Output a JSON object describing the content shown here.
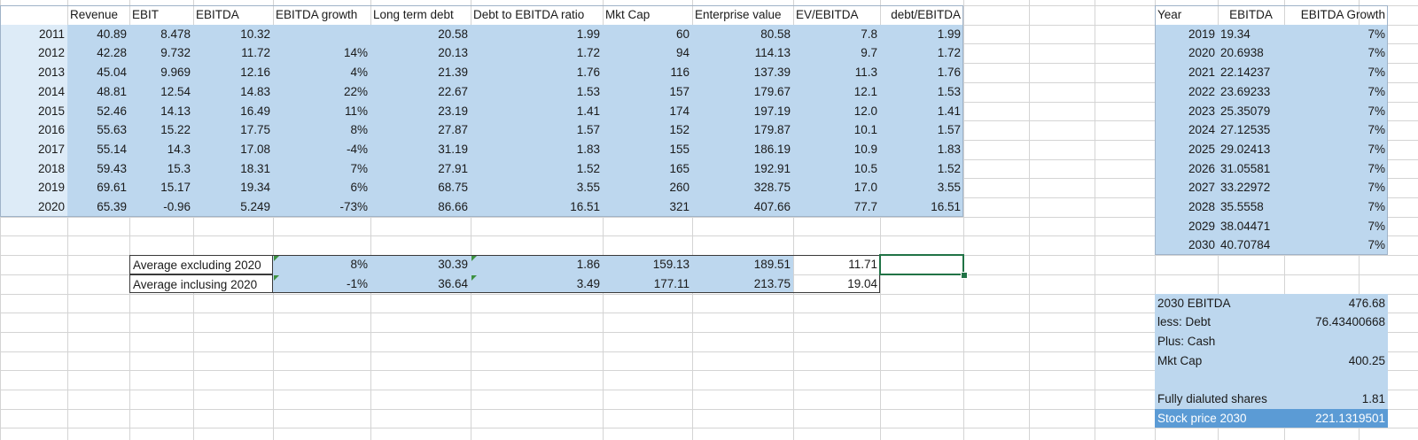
{
  "main_table": {
    "headers": [
      "Revenue",
      "EBIT",
      "EBITDA",
      "EBITDA growth",
      "Long term debt",
      "Debt to EBITDA ratio",
      "Mkt Cap",
      "Enterprise value",
      "EV/EBITDA",
      "debt/EBITDA"
    ],
    "rows": [
      [
        "2011",
        "40.89",
        "8.478",
        "10.32",
        "",
        "20.58",
        "1.99",
        "60",
        "80.58",
        "7.8",
        "1.99"
      ],
      [
        "2012",
        "42.28",
        "9.732",
        "11.72",
        "14%",
        "20.13",
        "1.72",
        "94",
        "114.13",
        "9.7",
        "1.72"
      ],
      [
        "2013",
        "45.04",
        "9.969",
        "12.16",
        "4%",
        "21.39",
        "1.76",
        "116",
        "137.39",
        "11.3",
        "1.76"
      ],
      [
        "2014",
        "48.81",
        "12.54",
        "14.83",
        "22%",
        "22.67",
        "1.53",
        "157",
        "179.67",
        "12.1",
        "1.53"
      ],
      [
        "2015",
        "52.46",
        "14.13",
        "16.49",
        "11%",
        "23.19",
        "1.41",
        "174",
        "197.19",
        "12.0",
        "1.41"
      ],
      [
        "2016",
        "55.63",
        "15.22",
        "17.75",
        "8%",
        "27.87",
        "1.57",
        "152",
        "179.87",
        "10.1",
        "1.57"
      ],
      [
        "2017",
        "55.14",
        "14.3",
        "17.08",
        "-4%",
        "31.19",
        "1.83",
        "155",
        "186.19",
        "10.9",
        "1.83"
      ],
      [
        "2018",
        "59.43",
        "15.3",
        "18.31",
        "7%",
        "27.91",
        "1.52",
        "165",
        "192.91",
        "10.5",
        "1.52"
      ],
      [
        "2019",
        "69.61",
        "15.17",
        "19.34",
        "6%",
        "68.75",
        "3.55",
        "260",
        "328.75",
        "17.0",
        "3.55"
      ],
      [
        "2020",
        "65.39",
        "-0.96",
        "5.249",
        "-73%",
        "86.66",
        "16.51",
        "321",
        "407.66",
        "77.7",
        "16.51"
      ]
    ]
  },
  "averages": [
    [
      "Average excluding 2020",
      "8%",
      "30.39",
      "1.86",
      "159.13",
      "189.51",
      "11.71"
    ],
    [
      "Average inclusing 2020",
      "-1%",
      "36.64",
      "3.49",
      "177.11",
      "213.75",
      "19.04"
    ]
  ],
  "projection": {
    "headers": [
      "Year",
      "EBITDA",
      "EBITDA Growth"
    ],
    "rows": [
      [
        "2019",
        "19.34",
        "7%"
      ],
      [
        "2020",
        "20.6938",
        "7%"
      ],
      [
        "2021",
        "22.14237",
        "7%"
      ],
      [
        "2022",
        "23.69233",
        "7%"
      ],
      [
        "2023",
        "25.35079",
        "7%"
      ],
      [
        "2024",
        "27.12535",
        "7%"
      ],
      [
        "2025",
        "29.02413",
        "7%"
      ],
      [
        "2026",
        "31.05581",
        "7%"
      ],
      [
        "2027",
        "33.22972",
        "7%"
      ],
      [
        "2028",
        "35.5558",
        "7%"
      ],
      [
        "2029",
        "38.04471",
        "7%"
      ],
      [
        "2030",
        "40.70784",
        "7%"
      ]
    ]
  },
  "valuation": [
    [
      "2030 EBITDA",
      "476.68"
    ],
    [
      "less: Debt",
      "76.43400668"
    ],
    [
      "Plus: Cash",
      ""
    ],
    [
      "Mkt Cap",
      "400.25"
    ],
    [
      "",
      ""
    ],
    [
      "Fully dialuted shares",
      "1.81"
    ],
    [
      "Stock price 2030",
      "221.1319501"
    ]
  ],
  "colors": {
    "table_fill": "#bdd7ee",
    "year_fill": "#ddebf7",
    "highlight_fill": "#5b9bd5",
    "selection": "#217346",
    "gridline": "#d4d4d4"
  }
}
